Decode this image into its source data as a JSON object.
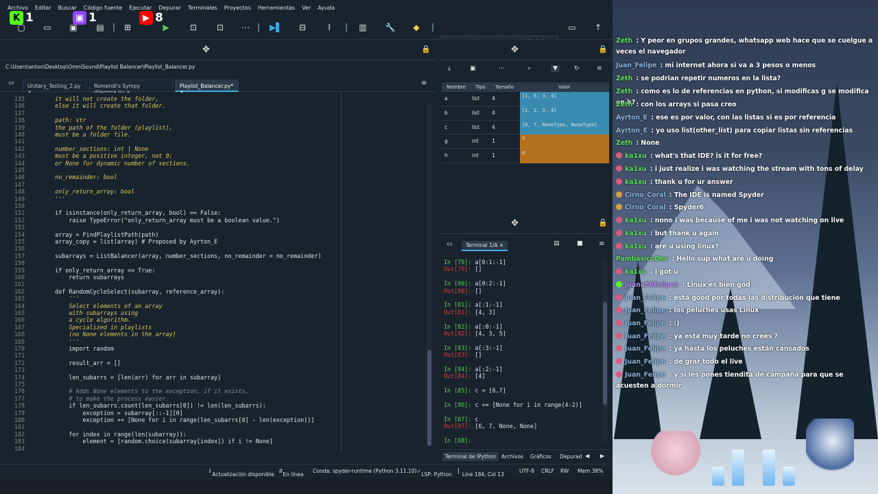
{
  "menu": [
    "Archivo",
    "Editar",
    "Buscar",
    "Código fuente",
    "Ejecutar",
    "Depurar",
    "Terminales",
    "Proyectos",
    "Herramientas",
    "Ver",
    "Ayuda"
  ],
  "badges": [
    {
      "icon": "kick-icon",
      "count": "1",
      "color": "#53fc18"
    },
    {
      "icon": "twitch-icon",
      "count": "1",
      "color": "#9146ff"
    },
    {
      "icon": "youtube-icon",
      "count": "8",
      "color": "#ff0000"
    }
  ],
  "toolbar": {
    "path": "...s\\anton\\desktop\\omnisound\\playlist balancer"
  },
  "editor": {
    "filepath": "C:\\Users\\anton\\Desktop\\OmniSound\\Playlist Balancer\\Playlist_Balancer.py",
    "tabs": [
      {
        "label": "Unitary_Testing_2.py"
      },
      {
        "label": "Romendi's Sympy dilemma.py"
      },
      {
        "label": "Playlist_Balancer.py*",
        "active": true
      }
    ],
    "lines": [
      {
        "n": "135",
        "t": "    it will not create the folder,",
        "c": "doc"
      },
      {
        "n": "136",
        "t": "    else it will create that folder.",
        "c": "doc"
      },
      {
        "n": "137",
        "t": "",
        "c": "doc"
      },
      {
        "n": "138",
        "t": "    path: str",
        "c": "doc"
      },
      {
        "n": "139",
        "t": "    the path of the folder (playlist),",
        "c": "doc"
      },
      {
        "n": "140",
        "t": "    must be a folder file.",
        "c": "doc"
      },
      {
        "n": "141",
        "t": "",
        "c": "doc"
      },
      {
        "n": "142",
        "t": "    number_sections: int | None",
        "c": "doc"
      },
      {
        "n": "143",
        "t": "    must be a positive integer, not 0;",
        "c": "doc"
      },
      {
        "n": "144",
        "t": "    or None for dynamic number of sections.",
        "c": "doc"
      },
      {
        "n": "145",
        "t": "",
        "c": "doc"
      },
      {
        "n": "146",
        "t": "    no_remainder: bool",
        "c": "doc"
      },
      {
        "n": "147",
        "t": "",
        "c": "doc"
      },
      {
        "n": "148",
        "t": "    only_return_array: bool",
        "c": "doc"
      },
      {
        "n": "149",
        "t": "    '''",
        "c": "doc"
      },
      {
        "n": "150",
        "t": "",
        "c": ""
      },
      {
        "n": "151",
        "t": "    if isinstance(only_return_array, bool) == False:",
        "c": ""
      },
      {
        "n": "152",
        "t": "        raise TypeError(\"only_return_array must be a boolean value.\")",
        "c": ""
      },
      {
        "n": "153",
        "t": "",
        "c": ""
      },
      {
        "n": "154",
        "t": "    array = FindPlaylistPath(path)",
        "c": ""
      },
      {
        "n": "155",
        "t": "    array_copy = list(array) # Proposed by Ayrton_E",
        "c": ""
      },
      {
        "n": "156",
        "t": "",
        "c": ""
      },
      {
        "n": "157",
        "t": "    subarrays = ListBalancer(array, number_sections, no_remainder = no_remainder)",
        "c": ""
      },
      {
        "n": "158",
        "t": "",
        "c": ""
      },
      {
        "n": "159",
        "t": "    if only_return_array == True:",
        "c": ""
      },
      {
        "n": "160",
        "t": "        return subarrays",
        "c": ""
      },
      {
        "n": "161",
        "t": "",
        "c": ""
      },
      {
        "n": "162",
        "t": "    def RandomCycleSelect(subarray, reference_array):",
        "c": ""
      },
      {
        "n": "163",
        "t": "        '''",
        "c": "doc"
      },
      {
        "n": "164",
        "t": "        Select elements of an array",
        "c": "doc"
      },
      {
        "n": "165",
        "t": "        with subarrays using",
        "c": "doc"
      },
      {
        "n": "166",
        "t": "        a cycle algorithm.",
        "c": "doc"
      },
      {
        "n": "167",
        "t": "        Specialized in playlists",
        "c": "doc"
      },
      {
        "n": "168",
        "t": "        (no None elements in the array)",
        "c": "doc"
      },
      {
        "n": "169",
        "t": "        '''",
        "c": "doc"
      },
      {
        "n": "170",
        "t": "        import random",
        "c": ""
      },
      {
        "n": "171",
        "t": "",
        "c": ""
      },
      {
        "n": "172",
        "t": "        result_arr = []",
        "c": ""
      },
      {
        "n": "173",
        "t": "",
        "c": ""
      },
      {
        "n": "174",
        "t": "        len_subarrs = [len(arr) for arr in subarray]",
        "c": ""
      },
      {
        "n": "175",
        "t": "",
        "c": ""
      },
      {
        "n": "176",
        "t": "        # Adds None elements to the exception, if it exists,",
        "c": "cm"
      },
      {
        "n": "177",
        "t": "        # to make the process easier.",
        "c": "cm"
      },
      {
        "n": "178",
        "t": "        if len_subarrs.count(len_subarrs[0]) != len(len_subarrs):",
        "c": ""
      },
      {
        "n": "179",
        "t": "            exception = subarray[::-1][0]",
        "c": ""
      },
      {
        "n": "180",
        "t": "            exception += [None for i in range(len_subarrs[0] - len(exception))]",
        "c": ""
      },
      {
        "n": "181",
        "t": "",
        "c": ""
      },
      {
        "n": "182",
        "t": "        for index in range(len(subarray)):",
        "c": ""
      },
      {
        "n": "183",
        "t": "            element = [random.choice(subarray[index]) if i != None]",
        "c": ""
      },
      {
        "n": "184",
        "t": "",
        "c": ""
      }
    ]
  },
  "variable_explorer": {
    "headers": [
      "Nombre",
      "Tipo",
      "Tamaño",
      "Valor"
    ],
    "rows": [
      {
        "name": "a",
        "type": "list",
        "size": "4",
        "value": "[1, 5, 3, 4]",
        "color": "#3a8bb0"
      },
      {
        "name": "b",
        "type": "list",
        "size": "4",
        "value": "[1, 2, 3, 4]",
        "color": "#3a8bb0"
      },
      {
        "name": "c",
        "type": "list",
        "size": "4",
        "value": "[6, 7, NoneType, NoneType]",
        "color": "#3a8bb0"
      },
      {
        "name": "g",
        "type": "int",
        "size": "1",
        "value": "5",
        "color": "#b5711e"
      },
      {
        "name": "h",
        "type": "int",
        "size": "1",
        "value": "0",
        "color": "#b5711e"
      }
    ]
  },
  "console": {
    "tab": "Terminal 1/A",
    "lines": [
      {
        "k": "in",
        "t": "In [79]: a[0:1:-1]"
      },
      {
        "k": "out",
        "t": "Out[79]: []"
      },
      {
        "k": "",
        "t": ""
      },
      {
        "k": "in",
        "t": "In [80]: a[0:2:-1]"
      },
      {
        "k": "out",
        "t": "Out[80]: []"
      },
      {
        "k": "",
        "t": ""
      },
      {
        "k": "in",
        "t": "In [81]: a[:1:-1]"
      },
      {
        "k": "out",
        "t": "Out[81]: [4, 3]"
      },
      {
        "k": "",
        "t": ""
      },
      {
        "k": "in",
        "t": "In [82]: a[:0:-1]"
      },
      {
        "k": "out",
        "t": "Out[82]: [4, 3, 5]"
      },
      {
        "k": "",
        "t": ""
      },
      {
        "k": "in",
        "t": "In [83]: a[:3:-1]"
      },
      {
        "k": "out",
        "t": "Out[83]: []"
      },
      {
        "k": "",
        "t": ""
      },
      {
        "k": "in",
        "t": "In [84]: a[:2:-1]"
      },
      {
        "k": "out",
        "t": "Out[84]: [4]"
      },
      {
        "k": "",
        "t": ""
      },
      {
        "k": "in",
        "t": "In [85]: c = [6,7]"
      },
      {
        "k": "",
        "t": ""
      },
      {
        "k": "in",
        "t": "In [86]: c += [None for i in range(4-2)]"
      },
      {
        "k": "",
        "t": ""
      },
      {
        "k": "in",
        "t": "In [87]: c"
      },
      {
        "k": "out",
        "t": "Out[87]: [6, 7, None, None]"
      },
      {
        "k": "",
        "t": ""
      },
      {
        "k": "in",
        "t": "In [88]: "
      }
    ],
    "bottom_tabs": [
      "Terminal de IPython",
      "Archivos",
      "Gráficos",
      "Depurad"
    ]
  },
  "status": {
    "update": "Actualización disponible",
    "online": "En línea",
    "conda": "Conda: spyder-runtime (Python 3.11.10)",
    "lsp": "LSP: Python",
    "pos": "Line 184, Col 13",
    "enc": "UTF-8",
    "eol": "CRLF",
    "rw": "RW",
    "mem": "Mem 38%"
  },
  "chat": [
    {
      "user": "Zeth",
      "msg": " : Y peor en grupos grandes, whatsapp web hace que se cuelgue a veces el navegador",
      "color": "#5de05d",
      "icon": ""
    },
    {
      "user": "Juan_Felipe",
      "msg": " : mi internet ahora si va a 3 pesos o menos",
      "color": "#8ab4d8",
      "icon": ""
    },
    {
      "user": "Zeth",
      "msg": " : se podrian repetir numeros en la lista?",
      "color": "#5de05d",
      "icon": ""
    },
    {
      "user": "Zeth",
      "msg": " : como es lo de referencias en python, si modificas g se modifica en h?",
      "color": "#5de05d",
      "icon": ""
    },
    {
      "user": "Zeth",
      "msg": " : con los arrays si pasa creo",
      "color": "#5de05d",
      "icon": ""
    },
    {
      "user": "Ayrton_E",
      "msg": " : ese es por valor, con las listas si es por referencia",
      "color": "#8ab4d8",
      "icon": ""
    },
    {
      "user": "Ayrton_E",
      "msg": " : yo uso list(other_list) para copiar listas sin referencias",
      "color": "#8ab4d8",
      "icon": ""
    },
    {
      "user": "Zeth",
      "msg": " : None",
      "color": "#5de05d",
      "icon": ""
    },
    {
      "user": "ka1xu",
      "msg": " : what's that IDE? is it for free?",
      "color": "#5de05d",
      "icon": "#e0577a"
    },
    {
      "user": "ka1xu",
      "msg": " : i just realize i was watching the stream with tons of delay",
      "color": "#5de05d",
      "icon": "#e0577a"
    },
    {
      "user": "ka1xu",
      "msg": " : thank u for ur answer",
      "color": "#5de05d",
      "icon": "#e0577a"
    },
    {
      "user": "Cirno_Coral",
      "msg": " : The IDE is named Spyder",
      "color": "#8ab4d8",
      "icon": "#d9a03a"
    },
    {
      "user": "Cirno_Coral",
      "msg": " : Spyder6",
      "color": "#8ab4d8",
      "icon": "#d9a03a"
    },
    {
      "user": "ka1xu",
      "msg": " : nono i was because of me i was not watching on live",
      "color": "#5de05d",
      "icon": "#e0577a"
    },
    {
      "user": "ka1xu",
      "msg": " : but thank u again",
      "color": "#5de05d",
      "icon": "#e0577a"
    },
    {
      "user": "ka1xu",
      "msg": " : are u using linux?",
      "color": "#5de05d",
      "icon": "#e0577a"
    },
    {
      "user": "PambasicoDev",
      "msg": " : Hello sup what are u doing",
      "color": "#5de05d",
      "icon": ""
    },
    {
      "user": "ka1xu",
      "msg": " : i got u",
      "color": "#5de05d",
      "icon": "#e0577a"
    },
    {
      "user": "juan456felipe2",
      "msg": " : Linux es bien god",
      "color": "#b58cf0",
      "icon": "#53fc18"
    },
    {
      "user": "Juan_Felipe",
      "msg": " : está good por todas las distribución que tiene",
      "color": "#8ab4d8",
      "icon": "#e0577a"
    },
    {
      "user": "Juan_Felipe",
      "msg": " : los peluches usas Linux",
      "color": "#8ab4d8",
      "icon": "#e0577a"
    },
    {
      "user": "Juan_Felipe",
      "msg": " : :)",
      "color": "#8ab4d8",
      "icon": "#e0577a"
    },
    {
      "user": "Juan_Felipe",
      "msg": " : ya está muy tarde no crees ?",
      "color": "#8ab4d8",
      "icon": "#e0577a"
    },
    {
      "user": "Juan_Felipe",
      "msg": " : ya hasta los peluches están cansados",
      "color": "#8ab4d8",
      "icon": "#e0577a"
    },
    {
      "user": "Juan_Felipe",
      "msg": " : de grar todo el live",
      "color": "#8ab4d8",
      "icon": "#e0577a"
    },
    {
      "user": "Juan_Felipe",
      "msg": " : y si les pones tiendita de campaña para que se acuesten a dormir",
      "color": "#8ab4d8",
      "icon": "#e0577a"
    }
  ]
}
